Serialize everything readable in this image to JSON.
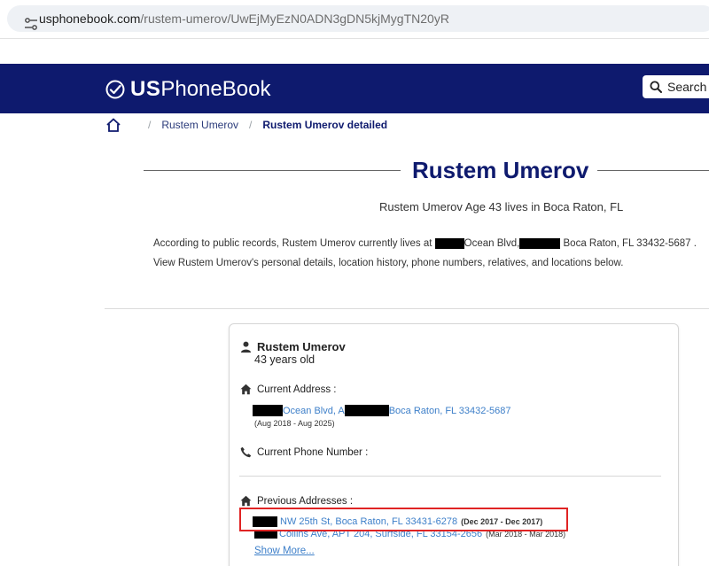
{
  "browser": {
    "url_host": "usphonebook.com",
    "url_path": "/rustem-umerov/UwEjMyEzN0ADN3gDN5kjMygTN20yR"
  },
  "header": {
    "logo_us": "US",
    "logo_phonebook": "PhoneBook",
    "search_label": "Search"
  },
  "breadcrumb": {
    "items": [
      {
        "label": "Rustem Umerov"
      },
      {
        "label": "Rustem Umerov detailed"
      }
    ],
    "separator": "/"
  },
  "page": {
    "title": "Rustem Umerov",
    "subtitle": "Rustem Umerov Age 43 lives in Boca Raton, FL",
    "intro_line1_a": "According to public records, Rustem Umerov currently lives at ",
    "intro_line1_b": "Ocean Blvd,",
    "intro_line1_c": " Boca Raton, FL 33432-5687 .",
    "intro_line2": "View Rustem Umerov's personal details, location history, phone numbers, relatives, and locations below."
  },
  "card": {
    "name": "Rustem Umerov",
    "age": "43 years old",
    "current_address_label": "Current Address :",
    "current_address": {
      "part1": "Ocean Blvd, A",
      "part2": "Boca Raton, FL 33432-5687",
      "dates": "(Aug 2018 - Aug 2025)"
    },
    "phone_label": "Current Phone Number :",
    "previous_label": "Previous Addresses :",
    "previous_addresses": [
      {
        "street": "NW 25th St, Boca Raton, FL 33431-6278",
        "dates": "(Dec 2017 - Dec 2017)"
      },
      {
        "street": "Collins Ave, APT 204, Surfside, FL 33154-2656",
        "dates": "(Mar 2018 - Mar 2018)"
      }
    ],
    "show_more": "Show More..."
  },
  "colors": {
    "brand_navy": "#0e1a6e",
    "link_blue": "#3d7fc9",
    "highlight_red": "#e02424"
  }
}
